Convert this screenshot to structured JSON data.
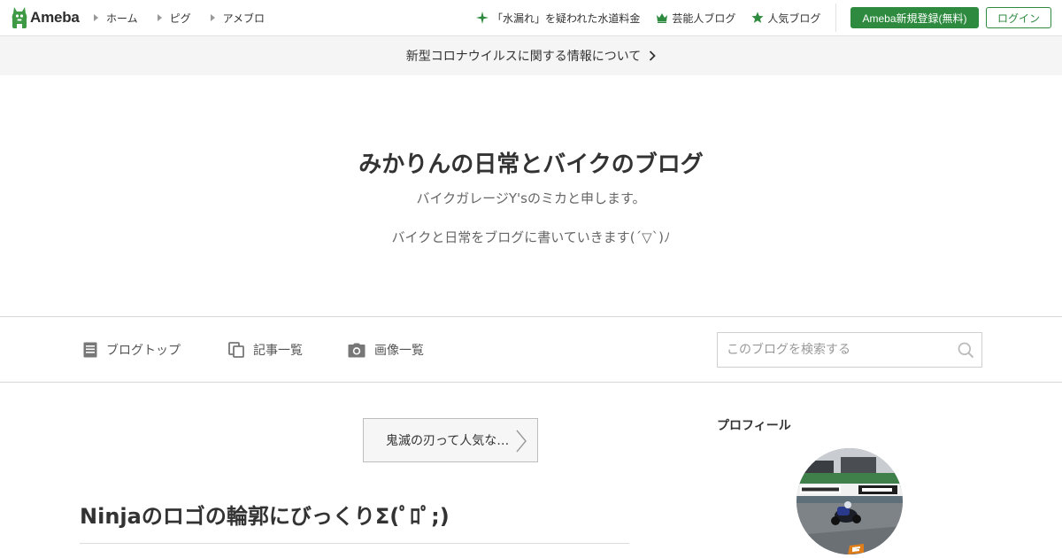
{
  "header": {
    "logo_text": "Ameba",
    "nav": [
      {
        "label": "ホーム"
      },
      {
        "label": "ピグ"
      },
      {
        "label": "アメブロ"
      }
    ],
    "links": [
      {
        "label": "「水漏れ」を疑われた水道料金",
        "icon": "sparkle-icon"
      },
      {
        "label": "芸能人ブログ",
        "icon": "crown-icon"
      },
      {
        "label": "人気ブログ",
        "icon": "star-icon"
      }
    ],
    "register_label": "Ameba新規登録(無料)",
    "login_label": "ログイン"
  },
  "notice": {
    "label": "新型コロナウイルスに関する情報について",
    "icon": "chevron-right-icon"
  },
  "blog": {
    "title": "みかりんの日常とバイクのブログ",
    "description_line1": "バイクガレージY'sのミカと申します。",
    "description_line2": "バイクと日常をブログに書いていきます(´▽`)ﾉ"
  },
  "blog_nav": {
    "items": [
      {
        "label": "ブログトップ",
        "icon": "document-icon"
      },
      {
        "label": "記事一覧",
        "icon": "copy-icon"
      },
      {
        "label": "画像一覧",
        "icon": "camera-icon"
      }
    ],
    "search_placeholder": "このブログを検索する",
    "search_icon": "search-icon"
  },
  "article": {
    "prev_entry_label": "鬼滅の刃って人気な…",
    "title": "Ninjaのロゴの輪郭にびっくりΣ(ﾟﾛﾟ;)"
  },
  "sidebar": {
    "profile_heading": "プロフィール"
  },
  "colors": {
    "brand_green": "#2d8a3e",
    "notice_bg": "#f5f5f5",
    "text": "#333333",
    "muted_text": "#666666"
  }
}
